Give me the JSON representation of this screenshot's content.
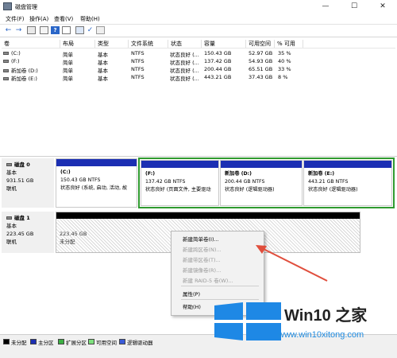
{
  "window": {
    "title": "磁盘管理",
    "minimize": "—",
    "maximize": "☐",
    "close": "✕"
  },
  "menu": [
    "文件(F)",
    "操作(A)",
    "查看(V)",
    "帮助(H)"
  ],
  "toolbar": {
    "icons": [
      "back-arrow-icon",
      "forward-arrow-icon",
      "console-tree-icon",
      "properties-icon",
      "help-icon",
      "list-icon",
      "connect-icon",
      "check-icon",
      "settings-icon"
    ]
  },
  "table": {
    "columns": [
      "卷",
      "布局",
      "类型",
      "文件系统",
      "状态",
      "容量",
      "可用空间",
      "% 可用"
    ],
    "rows": [
      [
        "(C:)",
        "简单",
        "基本",
        "NTFS",
        "状态良好 (...",
        "150.43 GB",
        "52.97 GB",
        "35 %"
      ],
      [
        "(F:)",
        "简单",
        "基本",
        "NTFS",
        "状态良好 (...",
        "137.42 GB",
        "54.93 GB",
        "40 %"
      ],
      [
        "新加卷 (D:)",
        "简单",
        "基本",
        "NTFS",
        "状态良好 (...",
        "200.44 GB",
        "65.51 GB",
        "33 %"
      ],
      [
        "新加卷 (E:)",
        "简单",
        "基本",
        "NTFS",
        "状态良好 (...",
        "443.21 GB",
        "37.43 GB",
        "8 %"
      ]
    ]
  },
  "disk0": {
    "name": "磁盘 0",
    "type": "基本",
    "size": "931.51 GB",
    "status": "联机",
    "volumes": [
      {
        "name": "(C:)",
        "size": "150.43 GB NTFS",
        "status": "状态良好 (系统, 启动, 活动, 故"
      },
      {
        "name": "(F:)",
        "size": "137.42 GB NTFS",
        "status": "状态良好 (页面文件, 主要驱动"
      },
      {
        "name": "新加卷 (D:)",
        "size": "200.44 GB NTFS",
        "status": "状态良好 (逻辑驱动器)"
      },
      {
        "name": "新加卷 (E:)",
        "size": "443.21 GB NTFS",
        "status": "状态良好 (逻辑驱动器)"
      }
    ]
  },
  "disk1": {
    "name": "磁盘 1",
    "type": "基本",
    "size": "223.45 GB",
    "status": "联机",
    "unallocated": {
      "size": "223.45 GB",
      "label": "未分配"
    }
  },
  "context_menu": {
    "items": [
      {
        "label": "新建简单卷(I)...",
        "enabled": true
      },
      {
        "label": "新建跨区卷(N)...",
        "enabled": false
      },
      {
        "label": "新建带区卷(T)...",
        "enabled": false
      },
      {
        "label": "新建镜像卷(R)...",
        "enabled": false
      },
      {
        "label": "新建 RAID-5 卷(W)...",
        "enabled": false
      },
      {
        "label": "属性(P)",
        "enabled": true
      },
      {
        "label": "帮助(H)",
        "enabled": true
      }
    ]
  },
  "legend": [
    {
      "label": "未分配",
      "color": "#000000"
    },
    {
      "label": "主分区",
      "color": "#1c2fb3"
    },
    {
      "label": "扩展分区",
      "color": "#3cb043"
    },
    {
      "label": "可用空间",
      "color": "#7ee07e"
    },
    {
      "label": "逻辑驱动器",
      "color": "#3a5bd8"
    }
  ],
  "watermark": {
    "title": "Win10 之家",
    "url": "www.win10xitong.com"
  },
  "colors": {
    "primary": "#1c2fb3",
    "extended": "#2f9a2f",
    "annotation_arrow": "#e04e3c"
  }
}
